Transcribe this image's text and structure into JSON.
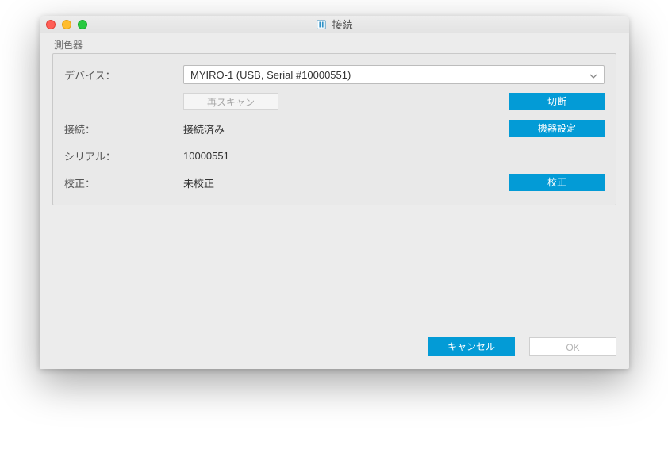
{
  "window": {
    "title": "接続"
  },
  "group": {
    "label": "測色器"
  },
  "fields": {
    "device_label": "デバイス：",
    "device_value": "MYIRO-1 (USB, Serial #10000551)",
    "rescan_label": "再スキャン",
    "disconnect_label": "切断",
    "connection_label": "接続：",
    "connection_value": "接続済み",
    "device_settings_label": "機器設定",
    "serial_label": "シリアル：",
    "serial_value": "10000551",
    "calibration_label": "校正：",
    "calibration_value": "未校正",
    "calibrate_label": "校正"
  },
  "footer": {
    "cancel_label": "キャンセル",
    "ok_label": "OK"
  }
}
